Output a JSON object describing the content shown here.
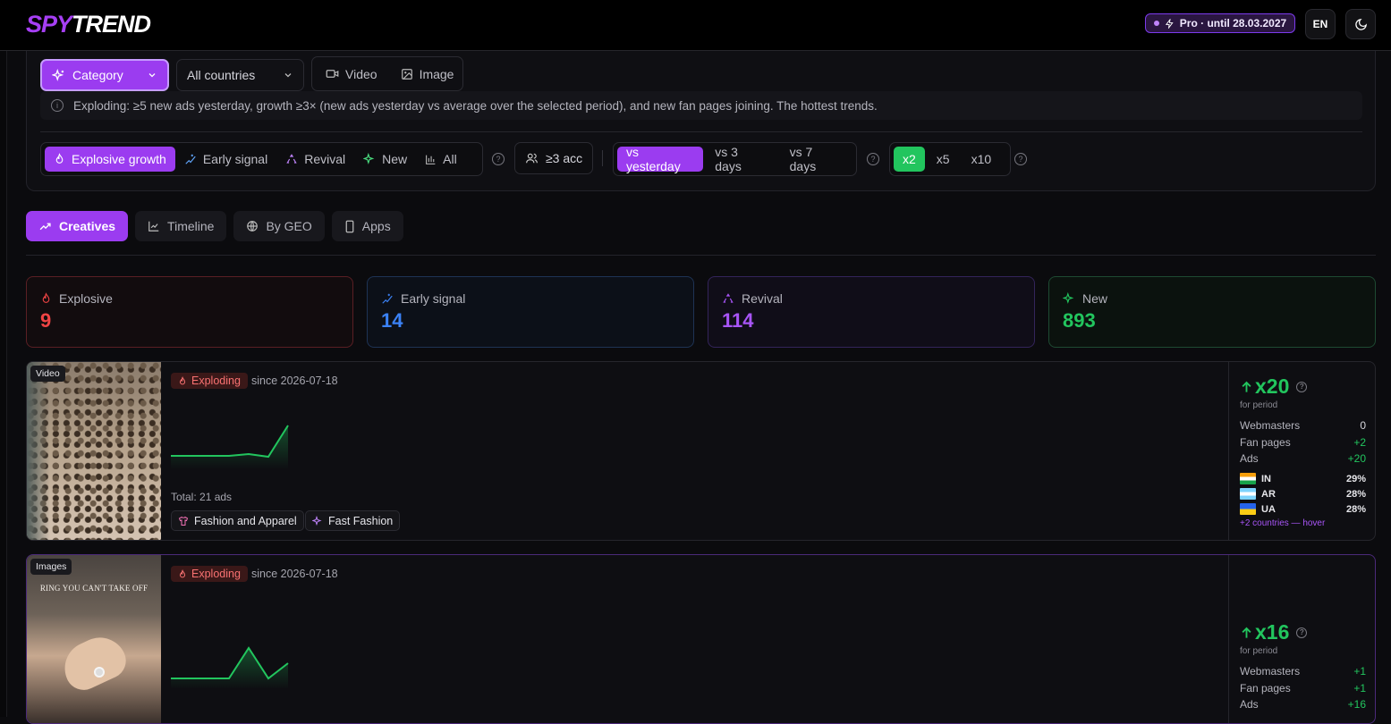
{
  "header": {
    "logo_a": "SPY",
    "logo_b": "TREND",
    "pro_label": "Pro · until 28.03.2027",
    "lang": "EN"
  },
  "filters": {
    "category": "Category",
    "country": "All countries",
    "media_types": [
      "Video",
      "Image"
    ],
    "info": "Exploding: ≥5 new ads yesterday, growth ≥3× (new ads yesterday vs average over the selected period), and new fan pages joining. The hottest trends.",
    "signals": [
      "Explosive growth",
      "Early signal",
      "Revival",
      "New",
      "All"
    ],
    "accounts": "≥3 acc",
    "compare": [
      "vs yesterday",
      "vs 3 days",
      "vs 7 days"
    ],
    "multipliers": [
      "x2",
      "x5",
      "x10"
    ]
  },
  "tabs": [
    "Creatives",
    "Timeline",
    "By GEO",
    "Apps"
  ],
  "stats": [
    {
      "label": "Explosive",
      "value": "9",
      "color": "#ef4444"
    },
    {
      "label": "Early signal",
      "value": "14",
      "color": "#3b82f6"
    },
    {
      "label": "Revival",
      "value": "114",
      "color": "#a855f7"
    },
    {
      "label": "New",
      "value": "893",
      "color": "#22c55e"
    }
  ],
  "cards": [
    {
      "type": "Video",
      "status": "Exploding",
      "since": "since 2026-07-18",
      "total": "Total: 21 ads",
      "tags": [
        "Fashion and Apparel",
        "Fast Fashion"
      ],
      "multiplier": "x20",
      "for_period": "for period",
      "webmasters_label": "Webmasters",
      "webmasters": "0",
      "fanpages_label": "Fan pages",
      "fanpages": "+2",
      "ads_label": "Ads",
      "ads": "+20",
      "geo": [
        {
          "code": "IN",
          "pct": "29%"
        },
        {
          "code": "AR",
          "pct": "28%"
        },
        {
          "code": "UA",
          "pct": "28%"
        }
      ],
      "more": "+2 countries — hover"
    },
    {
      "type": "Images",
      "status": "Exploding",
      "since": "since 2026-07-18",
      "image_text": "RING YOU CAN'T TAKE OFF",
      "multiplier": "x16",
      "for_period": "for period",
      "webmasters_label": "Webmasters",
      "webmasters": "+1",
      "fanpages_label": "Fan pages",
      "fanpages": "+1",
      "ads_label": "Ads",
      "ads": "+16"
    }
  ]
}
